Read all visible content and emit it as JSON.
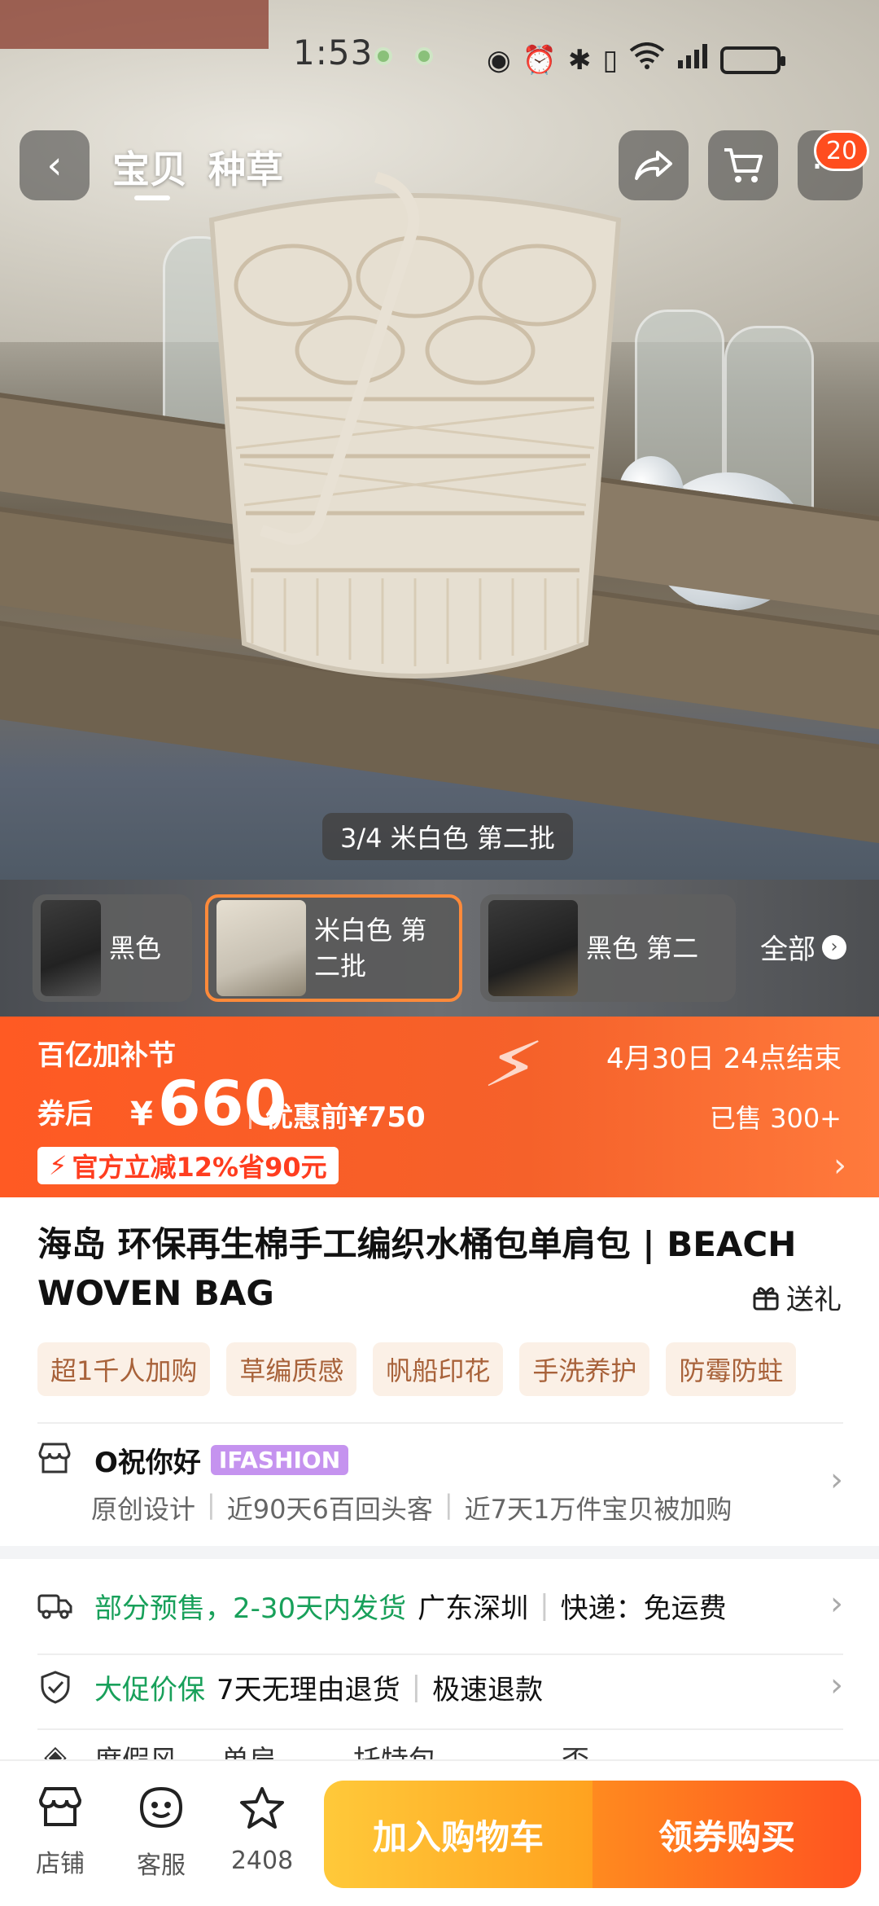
{
  "status_bar": {
    "time": "1:53"
  },
  "topbar": {
    "tabs": [
      "宝贝",
      "种草"
    ],
    "cart_badge": "20"
  },
  "gallery": {
    "indicator": "3/4 米白色 第二批"
  },
  "variants": {
    "items": [
      {
        "label": "黑色",
        "selected": false
      },
      {
        "label": "米白色 第二批",
        "selected": true
      },
      {
        "label": "黑色 第二",
        "selected": false
      }
    ],
    "all_label": "全部"
  },
  "price_banner": {
    "festival": "百亿加补节",
    "ends": "4月30日 24点结束",
    "coupon_label": "券后",
    "currency": "¥",
    "price": "660",
    "before_price": "优惠前¥750",
    "sold": "已售 300+",
    "promo": "官方立减12%省90元"
  },
  "product": {
    "title": "海岛 环保再生棉手工编织水桶包单肩包 | BEACH WOVEN BAG",
    "gift": "送礼",
    "tags": [
      "超1千人加购",
      "草编质感",
      "帆船印花",
      "手洗养护",
      "防霉防蛀"
    ]
  },
  "shop": {
    "name": "O祝你好",
    "badge": "IFASHION",
    "stats": [
      "原创设计",
      "近90天6百回头客",
      "近7天1万件宝贝被加购"
    ]
  },
  "shipping": {
    "status": "部分预售，2-30天内发货",
    "location": "广东深圳",
    "express": "快递：免运费"
  },
  "guarantee": {
    "label": "大促价保",
    "items": [
      "7天无理由退货",
      "极速退款"
    ]
  },
  "attributes": {
    "partial": [
      "度假风",
      "单肩",
      "托特包",
      "否"
    ]
  },
  "bottom_bar": {
    "store": "店铺",
    "service": "客服",
    "favorites": "2408",
    "add_to_cart": "加入购物车",
    "buy": "领券购买"
  },
  "colors": {
    "accent": "#ff5a23",
    "green": "#18a05a",
    "tag_bg": "#fbf0e6"
  }
}
